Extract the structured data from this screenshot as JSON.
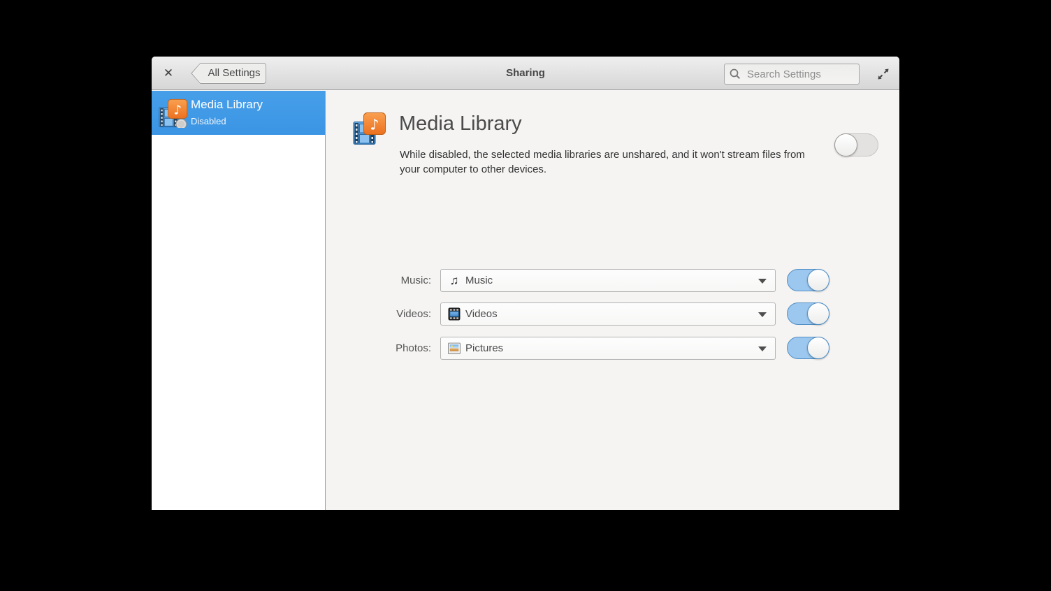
{
  "header": {
    "close": "✕",
    "back_label": "All Settings",
    "title": "Sharing",
    "search_placeholder": "Search Settings"
  },
  "sidebar": {
    "items": [
      {
        "title": "Media Library",
        "status": "Disabled",
        "selected": true,
        "icon": "media-library-icon",
        "badge": "disabled-badge"
      }
    ]
  },
  "main": {
    "title": "Media Library",
    "icon": "media-library-icon",
    "description": "While disabled, the selected media libraries are unshared, and it won't stream files from your computer to other devices.",
    "master_toggle_state": "off",
    "rows": [
      {
        "label": "Music:",
        "value": "Music",
        "icon": "music-note-icon",
        "toggle_state": "on"
      },
      {
        "label": "Videos:",
        "value": "Videos",
        "icon": "video-filmstrip-icon",
        "toggle_state": "on"
      },
      {
        "label": "Photos:",
        "value": "Pictures",
        "icon": "photo-icon",
        "toggle_state": "on"
      }
    ]
  },
  "colors": {
    "selection_blue": "#3d9ae9",
    "toggle_on_track": "#9cc7ee",
    "toggle_on_border": "#5290c5",
    "header_gradient_top": "#efefef",
    "header_gradient_bottom": "#d6d6d6",
    "main_background": "#f5f4f3",
    "icon_orange": "#f08437",
    "icon_film_blue": "#4f9fe3"
  }
}
